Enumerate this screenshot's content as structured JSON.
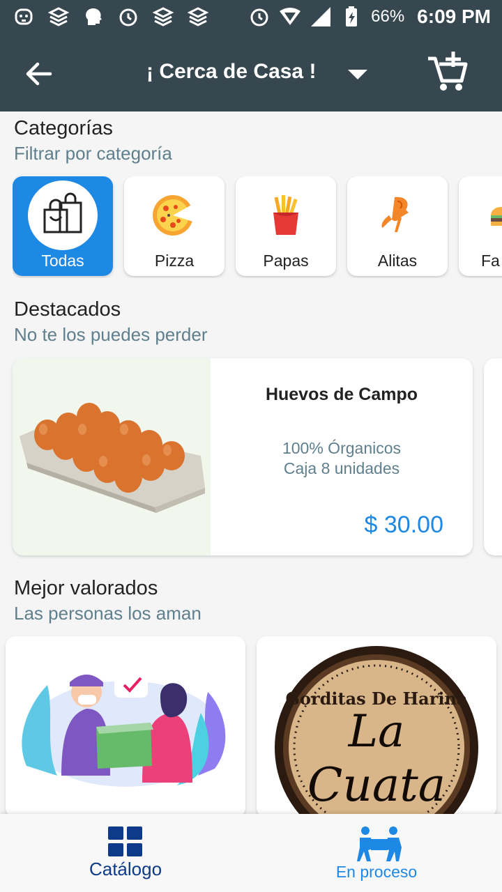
{
  "status_bar": {
    "battery_percent": "66%",
    "time": "6:09 PM",
    "left_icons": [
      "dog-app-icon",
      "layers-app-icon",
      "head-app-icon",
      "alarm-app-icon",
      "layers-app-icon",
      "layers-app-icon"
    ],
    "right_icons": [
      "alarm-icon",
      "wifi-icon",
      "signal-icon",
      "battery-charging-icon"
    ]
  },
  "app_bar": {
    "title": "¡ Cerca de Casa !",
    "icons": [
      "back-arrow-icon",
      "dropdown-arrow-icon",
      "add-to-cart-icon"
    ]
  },
  "categories": {
    "title": "Categorías",
    "subtitle": "Filtrar por categoría",
    "items": [
      {
        "label": "Todas",
        "icon": "shopping-bags-icon",
        "selected": true
      },
      {
        "label": "Pizza",
        "icon": "pizza-icon",
        "selected": false
      },
      {
        "label": "Papas",
        "icon": "fries-icon",
        "selected": false
      },
      {
        "label": "Alitas",
        "icon": "chicken-wing-icon",
        "selected": false
      },
      {
        "label": "Fa",
        "icon": "burger-icon",
        "selected": false
      }
    ]
  },
  "featured": {
    "title": "Destacados",
    "subtitle": "No te los puedes perder",
    "product": {
      "name": "Huevos de Campo",
      "description_line1": "100% Órganicos",
      "description_line2": "Caja 8 unidades",
      "price": "$ 30.00",
      "image": "egg-carton-image"
    }
  },
  "top_rated": {
    "title": "Mejor valorados",
    "subtitle": "Las personas los aman",
    "items": [
      {
        "image": "delivery-illustration-image"
      },
      {
        "image": "la-cuata-logo-image",
        "logo_text_top": "Gorditas De Harina",
        "logo_text_main1": "La",
        "logo_text_main2": "Cuata"
      }
    ]
  },
  "bottom_nav": {
    "items": [
      {
        "label": "Catálogo",
        "icon": "grid-icon",
        "color": "#0d3b8a"
      },
      {
        "label": "En proceso",
        "icon": "movers-icon",
        "color": "#1e88e5"
      }
    ]
  },
  "colors": {
    "app_bar": "#37474f",
    "accent": "#1e88e5",
    "subtitle": "#5f7f8d"
  }
}
